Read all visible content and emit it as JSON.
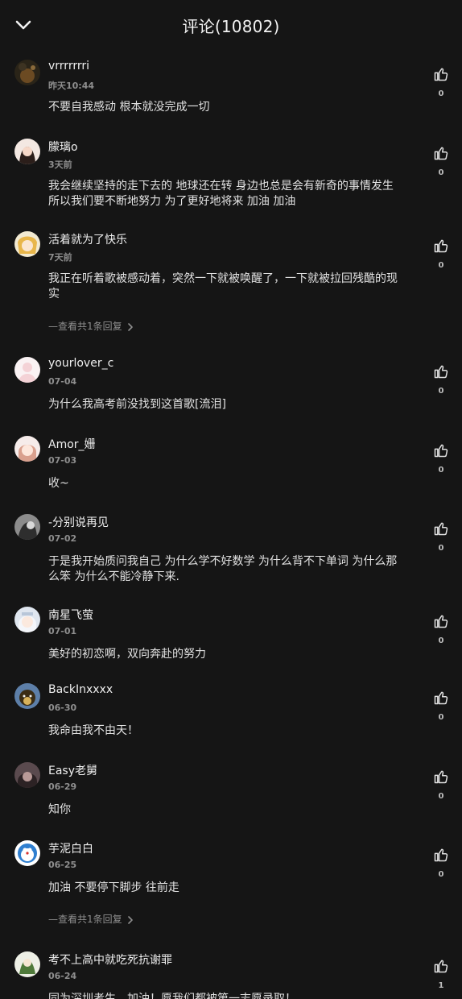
{
  "header": {
    "title": "评论(10802)"
  },
  "comments": [
    {
      "username": "vrrrrrrri",
      "time": "昨天10:44",
      "content": "不要自我感动 根本就没完成一切",
      "likes": "0"
    },
    {
      "username": "朦璃o",
      "time": "3天前",
      "content": "我会继续坚持的走下去的 地球还在转 身边也总是会有新奇的事情发生 所以我们要不断地努力 为了更好地将来 加油 加油",
      "likes": "0"
    },
    {
      "username": "活着就为了快乐",
      "time": "7天前",
      "content": "我正在听着歌被感动着，突然一下就被唤醒了，一下就被拉回残酷的现实",
      "likes": "0",
      "reply": "—查看共1条回复"
    },
    {
      "username": "yourlover_c",
      "time": "07-04",
      "content": "为什么我高考前没找到这首歌[流泪]",
      "likes": "0"
    },
    {
      "username": "Amor_姗",
      "time": "07-03",
      "content": "收~",
      "likes": "0"
    },
    {
      "username": "-分别说再见",
      "time": "07-02",
      "content": "于是我开始质问我自己 为什么学不好数学 为什么背不下单词 为什么那么笨 为什么不能冷静下来.",
      "likes": "0"
    },
    {
      "username": "南星飞萤",
      "time": "07-01",
      "content": "美好的初恋啊，双向奔赴的努力",
      "likes": "0"
    },
    {
      "username": "BackInxxxx",
      "time": "06-30",
      "content": "我命由我不由天！",
      "likes": "0"
    },
    {
      "username": "Easy老舅",
      "time": "06-29",
      "content": "知你",
      "likes": "0"
    },
    {
      "username": "芋泥白白",
      "time": "06-25",
      "content": "加油 不要停下脚步 往前走",
      "likes": "0",
      "reply": "—查看共1条回复"
    },
    {
      "username": "考不上高中就吃死抗谢罪",
      "time": "06-24",
      "content": "同为深圳考生，加油！愿我们都被第一志愿录取！",
      "likes": "1"
    }
  ],
  "icons": {
    "back": "chevron-down-icon",
    "like": "thumbs-up-icon",
    "reply_arrow": "chevron-right-icon"
  }
}
